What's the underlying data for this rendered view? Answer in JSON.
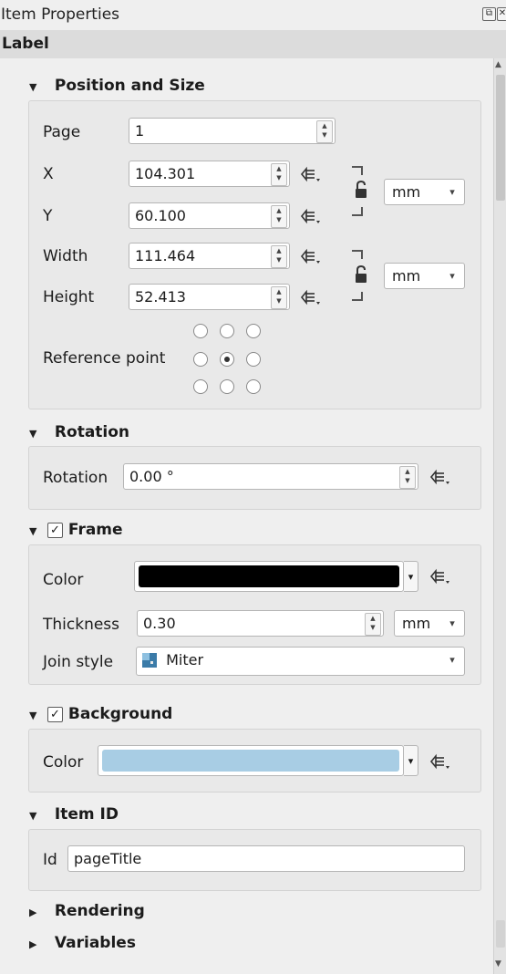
{
  "window": {
    "title": "Item Properties",
    "float_icon": "⧉",
    "close_icon": "✕"
  },
  "panel": {
    "label": "Label"
  },
  "position_size": {
    "header": "Position and Size",
    "page": {
      "label": "Page",
      "value": "1"
    },
    "x": {
      "label": "X",
      "value": "104.301"
    },
    "y": {
      "label": "Y",
      "value": "60.100"
    },
    "width": {
      "label": "Width",
      "value": "111.464"
    },
    "height": {
      "label": "Height",
      "value": "52.413"
    },
    "pos_unit": "mm",
    "size_unit": "mm",
    "reference_point": {
      "label": "Reference point",
      "selected": "middle-center"
    }
  },
  "rotation": {
    "header": "Rotation",
    "label": "Rotation",
    "value": "0.00 °"
  },
  "frame": {
    "header": "Frame",
    "checked": true,
    "color_label": "Color",
    "color_value": "#000000",
    "thickness_label": "Thickness",
    "thickness_value": "0.30",
    "thickness_unit": "mm",
    "join_label": "Join style",
    "join_value": "Miter"
  },
  "background": {
    "header": "Background",
    "checked": true,
    "color_label": "Color",
    "color_value": "#a8cde4"
  },
  "item_id": {
    "header": "Item ID",
    "label": "Id",
    "value": "pageTitle"
  },
  "collapsed": {
    "rendering": "Rendering",
    "variables": "Variables"
  },
  "colors": {
    "panel_bg": "#efefef",
    "group_bg": "#e9e9e9",
    "field_bg": "#ffffff"
  }
}
